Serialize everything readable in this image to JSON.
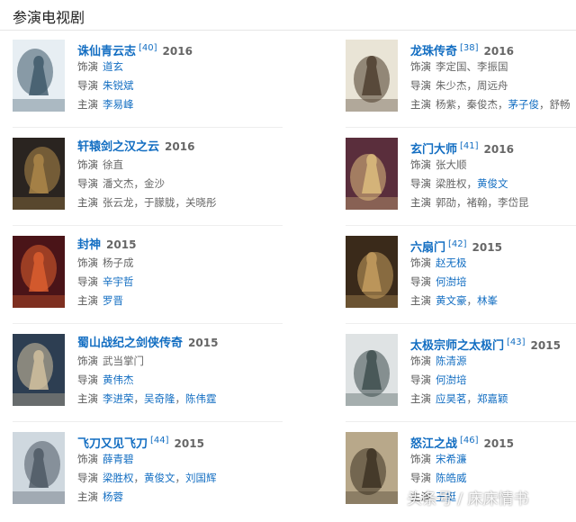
{
  "section_title": "参演电视剧",
  "labels": {
    "role": "饰演",
    "director": "导演",
    "starring": "主演"
  },
  "watermark": "头条号 / 床床情书",
  "dramas": [
    {
      "title": "诛仙青云志",
      "ref": "[40]",
      "year": "2016",
      "role": [
        {
          "t": "道玄",
          "link": true
        }
      ],
      "director": [
        {
          "t": "朱锐斌",
          "link": true
        }
      ],
      "starring": [
        {
          "t": "李易峰",
          "link": true
        }
      ],
      "poster": {
        "bg": "#e7eef3",
        "fg": "#3b5566"
      }
    },
    {
      "title": "龙珠传奇",
      "ref": "[38]",
      "year": "2016",
      "role": [
        {
          "t": "李定国、李振国",
          "link": false
        }
      ],
      "director": [
        {
          "t": "朱少杰",
          "link": false
        },
        {
          "t": "周远舟",
          "link": false
        }
      ],
      "starring": [
        {
          "t": "杨紫",
          "link": false
        },
        {
          "t": "秦俊杰",
          "link": false
        },
        {
          "t": "茅子俊",
          "link": true
        },
        {
          "t": "舒畅",
          "link": false
        }
      ],
      "poster": {
        "bg": "#e9e4d6",
        "fg": "#4a3a2a"
      }
    },
    {
      "title": "轩辕剑之汉之云",
      "ref": "",
      "year": "2016",
      "role": [
        {
          "t": "徐直",
          "link": false
        }
      ],
      "director": [
        {
          "t": "潘文杰",
          "link": false
        },
        {
          "t": "金沙",
          "link": false
        }
      ],
      "starring": [
        {
          "t": "张云龙",
          "link": false
        },
        {
          "t": "于朦胧",
          "link": false
        },
        {
          "t": "关晓彤",
          "link": false
        }
      ],
      "poster": {
        "bg": "#2a2420",
        "fg": "#b08a4a"
      }
    },
    {
      "title": "玄门大师",
      "ref": "[41]",
      "year": "2016",
      "role": [
        {
          "t": "张大顺",
          "link": false
        }
      ],
      "director": [
        {
          "t": "梁胜权",
          "link": false
        },
        {
          "t": "黄俊文",
          "link": true
        }
      ],
      "starring": [
        {
          "t": "郭劭",
          "link": false
        },
        {
          "t": "褚翰",
          "link": false
        },
        {
          "t": "李岱昆",
          "link": false
        }
      ],
      "poster": {
        "bg": "#5a2e3c",
        "fg": "#e0c080"
      }
    },
    {
      "title": "封神",
      "ref": "",
      "year": "2015",
      "role": [
        {
          "t": "杨子成",
          "link": false
        }
      ],
      "director": [
        {
          "t": "辛宇哲",
          "link": true
        }
      ],
      "starring": [
        {
          "t": "罗晋",
          "link": true
        }
      ],
      "poster": {
        "bg": "#4a1418",
        "fg": "#e06030"
      }
    },
    {
      "title": "六扇门",
      "ref": "[42]",
      "year": "2015",
      "role": [
        {
          "t": "赵无极",
          "link": true
        }
      ],
      "director": [
        {
          "t": "何澍培",
          "link": true
        }
      ],
      "starring": [
        {
          "t": "黄文豪",
          "link": true
        },
        {
          "t": "林峯",
          "link": true
        }
      ],
      "poster": {
        "bg": "#3a2a1a",
        "fg": "#c8a060"
      }
    },
    {
      "title": "蜀山战纪之剑侠传奇",
      "ref": "",
      "year": "2015",
      "role": [
        {
          "t": "武当掌门",
          "link": false
        }
      ],
      "director": [
        {
          "t": "黄伟杰",
          "link": true
        }
      ],
      "starring": [
        {
          "t": "李进荣",
          "link": true
        },
        {
          "t": "吴奇隆",
          "link": true
        },
        {
          "t": "陈伟霆",
          "link": true
        }
      ],
      "poster": {
        "bg": "#2d3e52",
        "fg": "#d6c3a0"
      }
    },
    {
      "title": "太极宗师之太极门",
      "ref": "[43]",
      "year": "2015",
      "role": [
        {
          "t": "陈清源",
          "link": true
        }
      ],
      "director": [
        {
          "t": "何澍培",
          "link": true
        }
      ],
      "starring": [
        {
          "t": "应昊茗",
          "link": true
        },
        {
          "t": "郑嘉颖",
          "link": true
        }
      ],
      "poster": {
        "bg": "#dfe3e4",
        "fg": "#3a4a4a"
      }
    },
    {
      "title": "飞刀又见飞刀",
      "ref": "[44]",
      "year": "2015",
      "role": [
        {
          "t": "薛青碧",
          "link": true
        }
      ],
      "director": [
        {
          "t": "梁胜权",
          "link": true
        },
        {
          "t": "黄俊文",
          "link": true
        },
        {
          "t": "刘国辉",
          "link": true
        }
      ],
      "starring": [
        {
          "t": "杨蓉",
          "link": true
        }
      ],
      "poster": {
        "bg": "#cfd8df",
        "fg": "#4a5560"
      }
    },
    {
      "title": "怒江之战",
      "ref": "[46]",
      "year": "2015",
      "role": [
        {
          "t": "宋希濂",
          "link": true
        }
      ],
      "director": [
        {
          "t": "陈皓威",
          "link": true
        }
      ],
      "starring": [
        {
          "t": "王挺",
          "link": true
        }
      ],
      "poster": {
        "bg": "#b8a88a",
        "fg": "#3a3020"
      }
    }
  ]
}
